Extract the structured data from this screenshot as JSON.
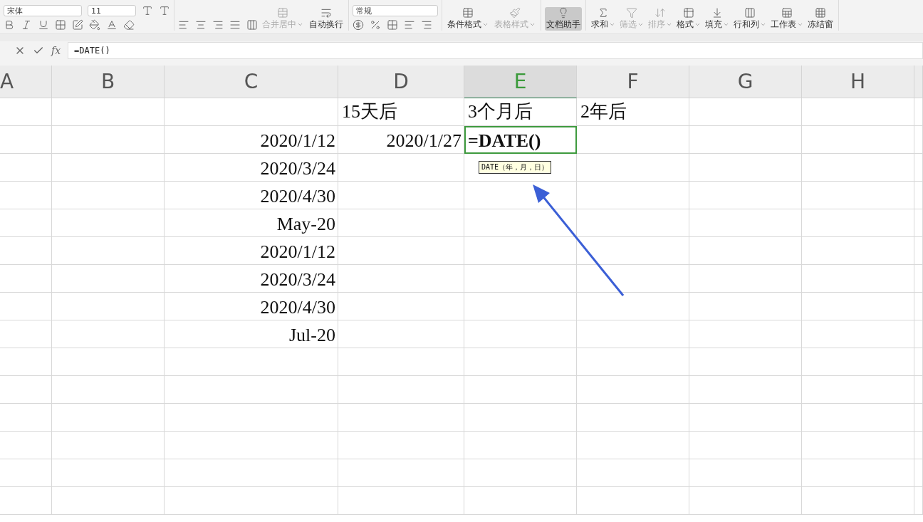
{
  "ribbon": {
    "font": "宋体",
    "font_size": "11",
    "number_format": "常规",
    "merge_buttons": [
      {
        "label": "合并居中",
        "disabled": true,
        "dropdown": true
      },
      {
        "label": "自动换行",
        "disabled": false,
        "dropdown": false
      }
    ],
    "style_buttons": [
      {
        "label": "条件格式",
        "disabled": false,
        "dropdown": true
      },
      {
        "label": "表格样式",
        "disabled": true,
        "dropdown": true
      }
    ],
    "assistant_button": {
      "label": "文档助手",
      "selected": true
    },
    "tool_buttons": [
      {
        "label": "求和",
        "disabled": false,
        "dropdown": true
      },
      {
        "label": "筛选",
        "disabled": true,
        "dropdown": true
      },
      {
        "label": "排序",
        "disabled": true,
        "dropdown": true
      },
      {
        "label": "格式",
        "disabled": false,
        "dropdown": true
      },
      {
        "label": "填充",
        "disabled": false,
        "dropdown": true
      },
      {
        "label": "行和列",
        "disabled": false,
        "dropdown": true
      },
      {
        "label": "工作表",
        "disabled": false,
        "dropdown": true
      },
      {
        "label": "冻结窗",
        "disabled": false,
        "dropdown": false
      }
    ]
  },
  "formula_bar": {
    "fx": "fx",
    "value": "=DATE()"
  },
  "columns": [
    {
      "label": "A",
      "selected": false
    },
    {
      "label": "B",
      "selected": false
    },
    {
      "label": "C",
      "selected": false
    },
    {
      "label": "D",
      "selected": false
    },
    {
      "label": "E",
      "selected": true
    },
    {
      "label": "F",
      "selected": false
    },
    {
      "label": "G",
      "selected": false
    },
    {
      "label": "H",
      "selected": false
    }
  ],
  "rows": [
    {
      "D": {
        "kind": "text",
        "text": "15天后"
      },
      "E": {
        "kind": "text",
        "text": "3个月后"
      },
      "F": {
        "kind": "text",
        "text": "2年后"
      }
    },
    {
      "C": {
        "kind": "date",
        "text": "2020/1/12"
      },
      "D": {
        "kind": "date",
        "text": "2020/1/27"
      },
      "E": {
        "kind": "formula",
        "text": "=DATE()",
        "hint": "DATE（年，月，日）"
      }
    },
    {
      "C": {
        "kind": "date",
        "text": "2020/3/24"
      }
    },
    {
      "C": {
        "kind": "date",
        "text": "2020/4/30"
      }
    },
    {
      "C": {
        "kind": "date",
        "text": "May-20"
      }
    },
    {
      "C": {
        "kind": "date",
        "text": "2020/1/12"
      }
    },
    {
      "C": {
        "kind": "date",
        "text": "2020/3/24"
      }
    },
    {
      "C": {
        "kind": "date",
        "text": "2020/4/30"
      }
    },
    {
      "C": {
        "kind": "date",
        "text": "Jul-20"
      }
    }
  ]
}
